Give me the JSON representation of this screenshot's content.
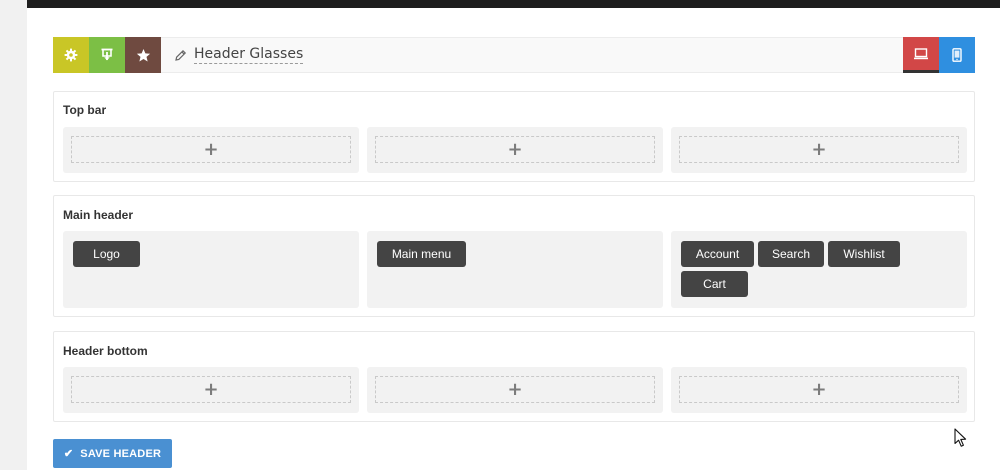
{
  "header_title": "Header Glasses",
  "toolbar": {
    "left_icons": [
      "gear-icon",
      "import-icon",
      "star-icon"
    ],
    "right_icons": [
      "desktop-icon",
      "mobile-icon"
    ]
  },
  "rows": {
    "top_bar": {
      "label": "Top bar"
    },
    "main_header": {
      "label": "Main header",
      "left_items": [
        "Logo"
      ],
      "center_items": [
        "Main menu"
      ],
      "right_items": [
        "Account",
        "Search",
        "Wishlist",
        "Cart"
      ]
    },
    "header_bottom": {
      "label": "Header bottom"
    }
  },
  "add_symbol": "+",
  "save_button": {
    "label": "SAVE HEADER",
    "icon": "check-icon"
  },
  "colors": {
    "settings": "#c9c626",
    "import": "#7cbf45",
    "preset": "#6f4a40",
    "desktop": "#d24747",
    "mobile": "#2f8fe0",
    "save": "#4a90d2",
    "item": "#444444"
  }
}
